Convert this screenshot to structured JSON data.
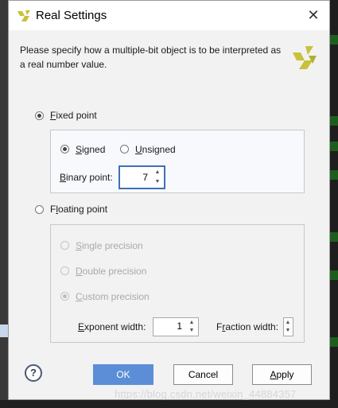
{
  "window": {
    "title": "Real Settings",
    "close_label": "✕"
  },
  "description": "Please specify how a multiple-bit object is to be interpreted as a real number value.",
  "fixed_point": {
    "label_key": "F",
    "label_rest": "ixed point",
    "selected": true,
    "signed": {
      "label_key": "S",
      "label_rest": "igned",
      "selected": true
    },
    "unsigned": {
      "label_key": "U",
      "label_rest": "nsigned",
      "selected": false
    },
    "binary_point": {
      "label_key": "B",
      "label_rest": "inary point:",
      "value": "7"
    }
  },
  "floating_point": {
    "label_key": "l",
    "label_pre": "F",
    "label_rest": "oating point",
    "selected": false,
    "single": {
      "label_key": "S",
      "label_rest": "ingle precision",
      "selected": false
    },
    "double": {
      "label_key": "D",
      "label_rest": "ouble precision",
      "selected": false
    },
    "custom": {
      "label_key": "C",
      "label_rest": "ustom precision",
      "selected": true
    },
    "exponent_width": {
      "label_key": "E",
      "label_rest": "xponent width:",
      "value": "1"
    },
    "fraction_width": {
      "label_key": "r",
      "label_pre": "F",
      "label_rest": "action width:",
      "value": ""
    }
  },
  "buttons": {
    "help": "?",
    "ok": "OK",
    "cancel": "Cancel",
    "apply_key": "A",
    "apply_rest": "pply"
  },
  "watermark": "https://blog.csdn.net/weixin_44884357",
  "colors": {
    "accent": "#5b8ed6",
    "logo": "#c7c23a",
    "focus": "#3e6fb6"
  }
}
